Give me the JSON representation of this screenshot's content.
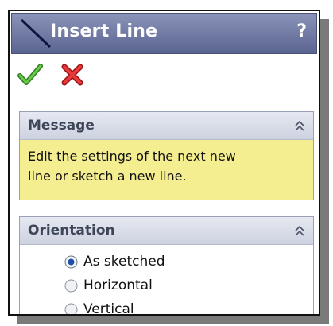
{
  "panel": {
    "title": "Insert Line",
    "help": "?",
    "icons": [
      "line-icon",
      "check-icon",
      "close-icon",
      "collapse-icon"
    ],
    "colors": {
      "titlebar": "#6b74a0",
      "message_bg": "#f5ee91",
      "ok": "#49a832",
      "cancel": "#d9282b"
    }
  },
  "message": {
    "title": "Message",
    "text_line1": "Edit the settings of the next new",
    "text_line2": "line or sketch a new line."
  },
  "orientation": {
    "title": "Orientation",
    "options": [
      {
        "label": "As sketched",
        "selected": true
      },
      {
        "label": "Horizontal",
        "selected": false
      },
      {
        "label": "Vertical",
        "selected": false
      }
    ]
  }
}
